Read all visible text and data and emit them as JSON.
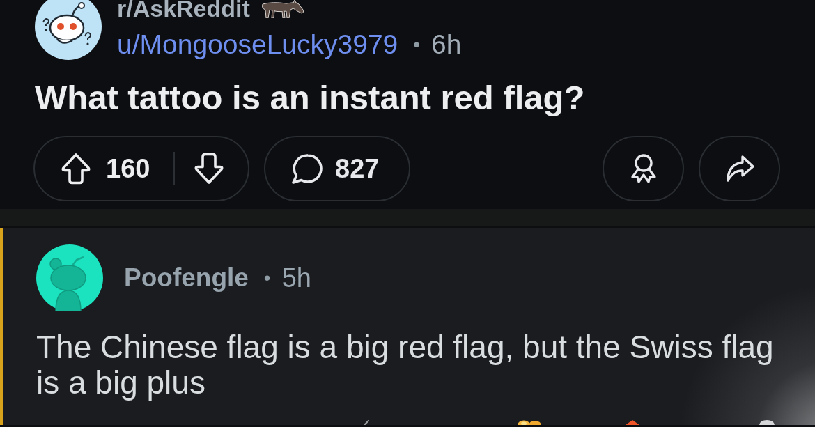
{
  "post": {
    "subreddit": "r/AskReddit",
    "author": "u/MongooseLucky3979",
    "separator": "•",
    "age": "6h",
    "title": "What tattoo is an instant red flag?",
    "votes": "160",
    "comments": "827"
  },
  "comment": {
    "highlighted": true,
    "author": "Poofengle",
    "separator": "•",
    "age": "5h",
    "body": "The Chinese flag is a big red flag, but the Swiss flag is a big plus"
  }
}
